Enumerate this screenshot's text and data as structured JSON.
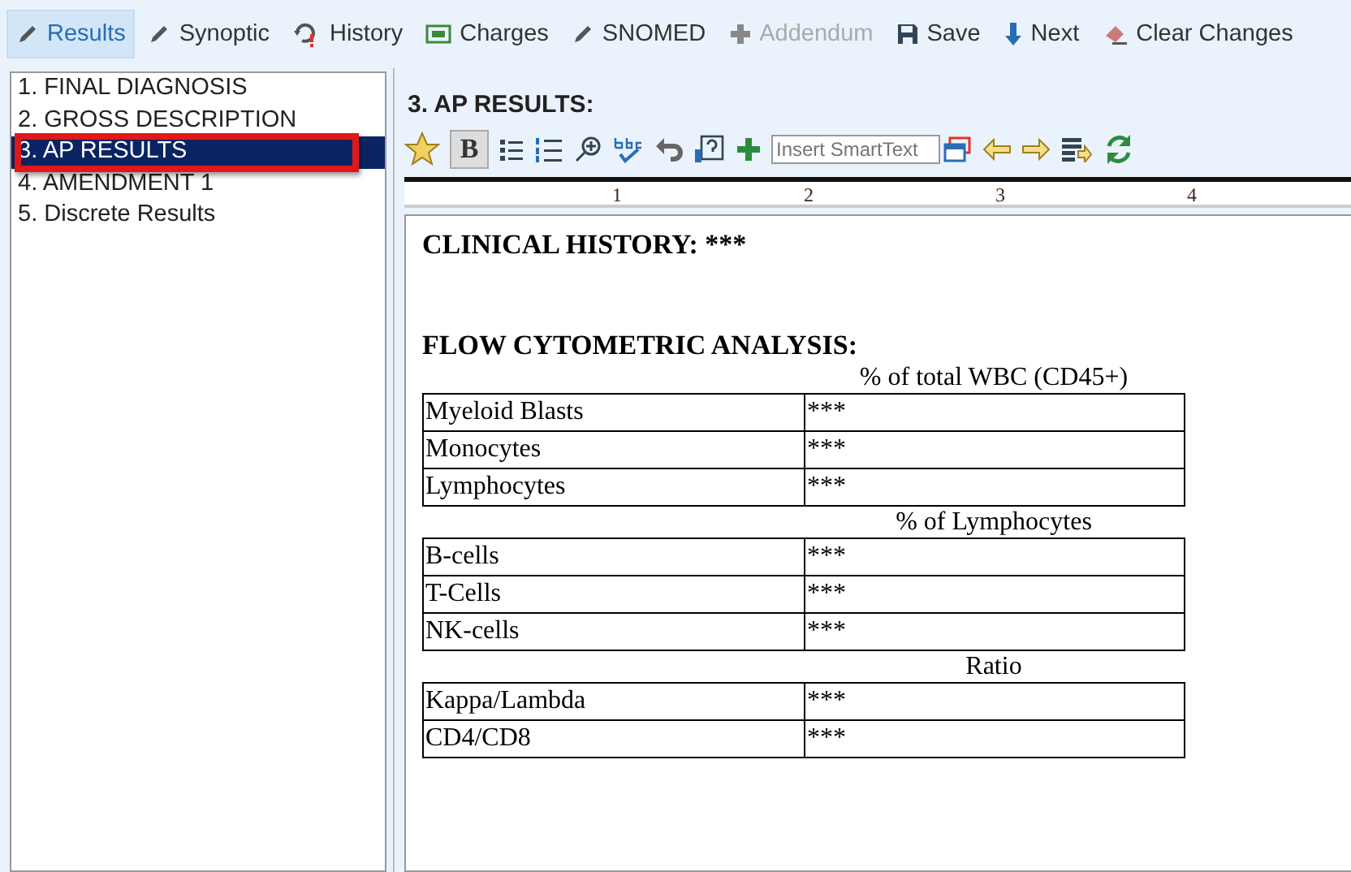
{
  "toolbar": [
    {
      "label": "Results",
      "kind": "pencil",
      "selected": true,
      "disabled": false
    },
    {
      "label": "Synoptic",
      "kind": "pencil",
      "selected": false,
      "disabled": false
    },
    {
      "label": "History",
      "kind": "history",
      "selected": false,
      "disabled": false
    },
    {
      "label": "Charges",
      "kind": "money",
      "selected": false,
      "disabled": false
    },
    {
      "label": "SNOMED",
      "kind": "pencil",
      "selected": false,
      "disabled": false
    },
    {
      "label": "Addendum",
      "kind": "plus",
      "selected": false,
      "disabled": true
    },
    {
      "label": "Save",
      "kind": "save",
      "selected": false,
      "disabled": false
    },
    {
      "label": "Next",
      "kind": "down",
      "selected": false,
      "disabled": false
    },
    {
      "label": "Clear Changes",
      "kind": "eraser",
      "selected": false,
      "disabled": false
    }
  ],
  "sections": [
    {
      "label": "1. FINAL DIAGNOSIS",
      "selected": false
    },
    {
      "label": "2. GROSS DESCRIPTION",
      "selected": false
    },
    {
      "label": "3. AP RESULTS",
      "selected": true
    },
    {
      "label": "4. AMENDMENT 1",
      "selected": false
    },
    {
      "label": "5. Discrete Results",
      "selected": false
    }
  ],
  "editor": {
    "title": "3. AP RESULTS:",
    "bold_button": {
      "label": "B",
      "pressed": true
    },
    "smarttext": {
      "placeholder": "Insert SmartText"
    },
    "ruler": [
      "1",
      "2",
      "3",
      "4"
    ],
    "document": {
      "heading": "CLINICAL HISTORY: ***",
      "subheading": "FLOW CYTOMETRIC ANALYSIS:",
      "groups": [
        {
          "caption": "% of total WBC (CD45+)",
          "rows": [
            {
              "label": "Myeloid Blasts",
              "value": "***"
            },
            {
              "label": "Monocytes",
              "value": "***"
            },
            {
              "label": "Lymphocytes",
              "value": "***"
            }
          ]
        },
        {
          "caption": "% of Lymphocytes",
          "rows": [
            {
              "label": "B-cells",
              "value": "***"
            },
            {
              "label": "T-Cells",
              "value": "***"
            },
            {
              "label": "NK-cells",
              "value": "***"
            }
          ]
        },
        {
          "caption": "Ratio",
          "rows": [
            {
              "label": "Kappa/Lambda",
              "value": "***"
            },
            {
              "label": "CD4/CD8",
              "value": "***"
            }
          ]
        }
      ]
    }
  }
}
